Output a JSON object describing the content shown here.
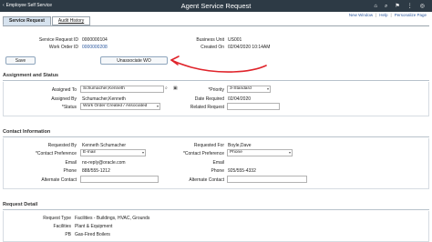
{
  "topbar": {
    "back_label": "Employee Self Service",
    "title": "Agent Service Request"
  },
  "toplinks": {
    "new_window": "New Window",
    "sep1": "|",
    "help": "Help",
    "sep2": "|",
    "personalize": "Personalize Page"
  },
  "tabs": [
    {
      "label": "Service Request"
    },
    {
      "label": "Audit History"
    }
  ],
  "header": {
    "sr_id_label": "Service Request ID",
    "sr_id_value": "0000000104",
    "wo_id_label": "Work Order ID",
    "wo_id_value": "0000000208",
    "bu_label": "Business Unit",
    "bu_value": "US001",
    "created_label": "Created On",
    "created_value": "02/04/2020 10:14AM"
  },
  "buttons": {
    "save": "Save",
    "unassociate": "Unassociate WO"
  },
  "assignment": {
    "title": "Assignment and Status",
    "assigned_to_label": "Assigned To",
    "assigned_to_value": "Schumacher,Kenneth",
    "assigned_by_label": "Assigned By",
    "assigned_by_value": "Schumacher,Kenneth",
    "status_label": "*Status",
    "status_value": "Work Order Created / Associated",
    "priority_label": "*Priority",
    "priority_value": "3-Standard",
    "date_required_label": "Date Required",
    "date_required_value": "02/04/2020",
    "related_label": "Related Request",
    "related_value": ""
  },
  "contact": {
    "title": "Contact Information",
    "requested_by_label": "Requested By",
    "requested_by_value": "Kenneth Schumacher",
    "contact_pref_label": "*Contact Preference",
    "contact_pref_value": "E-mail",
    "email_label": "Email",
    "email_value": "no-reply@oracle.com",
    "phone_label": "Phone",
    "phone_value": "888/555-1212",
    "alt_contact_label": "Alternate Contact",
    "alt_contact_value": "",
    "requested_for_label": "Requested For",
    "requested_for_value": "Boyle,Dave",
    "contact_pref2_label": "*Contact Preference",
    "contact_pref2_value": "Phone",
    "email2_label": "Email",
    "email2_value": "",
    "phone2_label": "Phone",
    "phone2_value": "925/555-4332",
    "alt_contact2_label": "Alternate Contact",
    "alt_contact2_value": ""
  },
  "detail": {
    "title": "Request Detail",
    "request_type_label": "Request Type",
    "request_type_value": "Facilities - Buildings, HVAC, Grounds",
    "facilities_label": "Facilities",
    "facilities_value": "Plant & Equipment",
    "pb_label": "PB",
    "pb_value": "Gas-Fired Boilers"
  },
  "colors": {
    "topbar": "#2d3a45",
    "link": "#2d5aa0",
    "annotation_arrow": "#e0242b"
  }
}
